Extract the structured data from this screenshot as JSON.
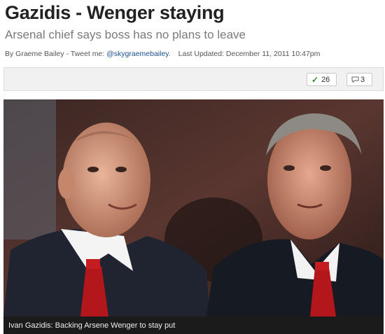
{
  "article": {
    "headline": "Gazidis - Wenger staying",
    "subheadline": "Arsenal chief says boss has no plans to leave",
    "byline": {
      "author_prefix": "By Graeme Bailey - Tweet me: ",
      "twitter_handle": "@skygraemebailey",
      "after_handle": ".",
      "updated": "Last Updated: December 11, 2011 10:47pm"
    }
  },
  "share_bar": {
    "likes_icon": "checkmark-icon",
    "likes_count": "26",
    "comments_icon": "speech-bubble-icon",
    "comments_count": "3"
  },
  "photo": {
    "caption": "Ivan Gazidis: Backing Arsene Wenger to stay put"
  },
  "colors": {
    "headline": "#222222",
    "subheadline": "#7a7a7a",
    "link": "#1a4f8a",
    "caption_bg": "#1b1b1b",
    "tie": "#b3161b"
  }
}
